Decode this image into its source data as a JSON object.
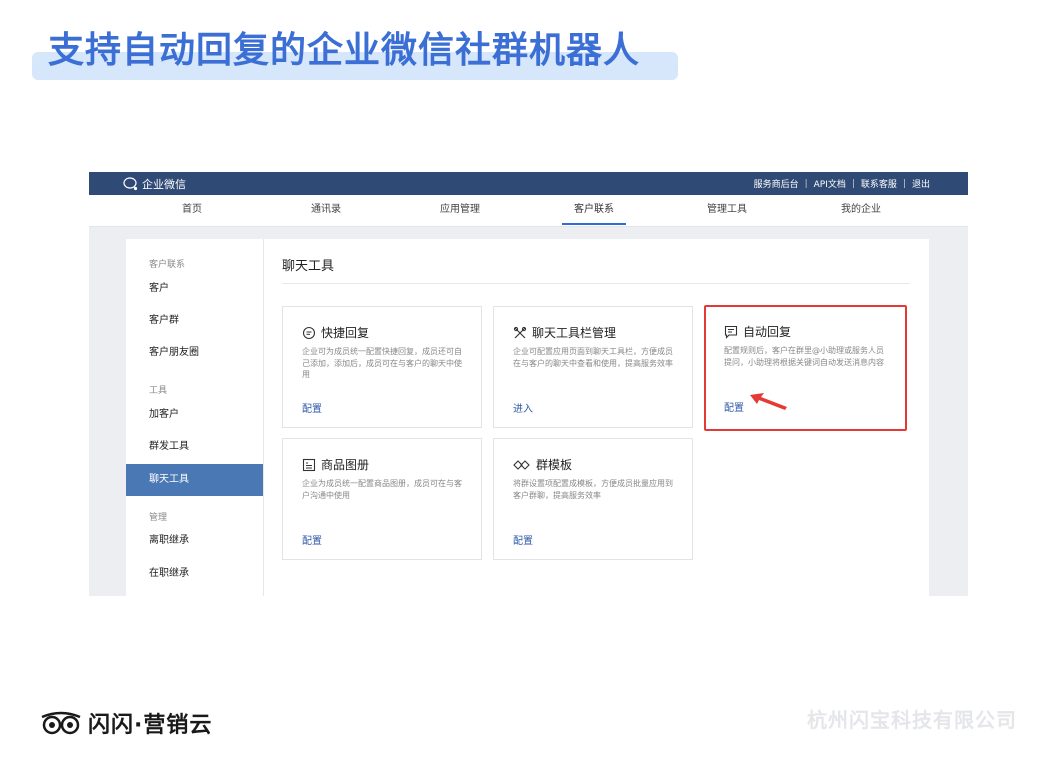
{
  "slide": {
    "title": "支持自动回复的企业微信社群机器人",
    "footer_brand": "闪闪·营销云",
    "footer_company": "杭州闪宝科技有限公司"
  },
  "app": {
    "brand": "企业微信",
    "top_links": [
      "服务商后台",
      "API文档",
      "联系客服",
      "退出"
    ],
    "nav": [
      {
        "label": "首页",
        "active": false
      },
      {
        "label": "通讯录",
        "active": false
      },
      {
        "label": "应用管理",
        "active": false
      },
      {
        "label": "客户联系",
        "active": true
      },
      {
        "label": "管理工具",
        "active": false
      },
      {
        "label": "我的企业",
        "active": false
      }
    ],
    "sidebar": {
      "group1": "客户联系",
      "items1": [
        "客户",
        "客户群",
        "客户朋友圈"
      ],
      "group2": "工具",
      "items2": [
        "加客户",
        "群发工具",
        "聊天工具"
      ],
      "group3": "管理",
      "items3": [
        "离职继承",
        "在职继承"
      ],
      "active": "聊天工具"
    },
    "content_title": "聊天工具",
    "cards": [
      {
        "icon": "chat-bubble-icon",
        "title": "快捷回复",
        "desc": "企业可为成员统一配置快捷回复，成员还可自己添加，添加后，成员可在与客户的聊天中使用",
        "link": "配置"
      },
      {
        "icon": "tools-icon",
        "title": "聊天工具栏管理",
        "desc": "企业可配置应用页面到聊天工具栏，方便成员在与客户的聊天中查看和使用，提高服务效率",
        "link": "进入"
      },
      {
        "icon": "auto-reply-icon",
        "title": "自动回复",
        "desc": "配置规则后，客户在群里@小助理或服务人员提问，小助理将根据关键词自动发送消息内容",
        "link": "配置"
      },
      {
        "icon": "album-icon",
        "title": "商品图册",
        "desc": "企业为成员统一配置商品图册，成员可在与客户沟通中使用",
        "link": "配置"
      },
      {
        "icon": "template-icon",
        "title": "群模板",
        "desc": "将群设置项配置成模板，方便成员批量应用到客户群聊，提高服务效率",
        "link": "配置"
      }
    ],
    "highlight_color": "#e33a36",
    "nav_bar_color": "#2f4a74",
    "accent_color": "#2f6cd6"
  }
}
